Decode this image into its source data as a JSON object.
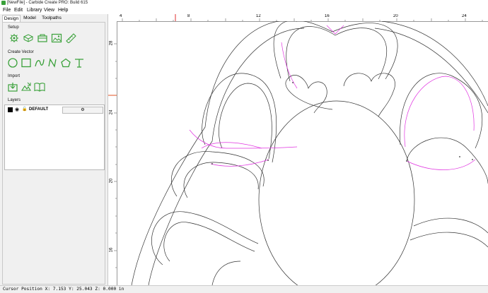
{
  "window": {
    "title": "[NewFile] - Carbide Create PRO: Build 615"
  },
  "menu": {
    "items": [
      "File",
      "Edit",
      "Library",
      "View",
      "Help"
    ]
  },
  "tabs": [
    "Design",
    "Model",
    "Toolpaths"
  ],
  "sections": {
    "setup": "Setup",
    "create_vector": "Create Vector",
    "import": "Import",
    "layers": "Layers"
  },
  "icons": {
    "setup": [
      "job-setup-icon",
      "plane-icon",
      "toolbox-icon",
      "image-icon",
      "ruler-icon"
    ],
    "create_vector": [
      "circle-icon",
      "rectangle-icon",
      "curve-icon",
      "polyline-icon",
      "polygon-icon",
      "text-icon"
    ],
    "import": [
      "import-file-icon",
      "import-image-icon",
      "open-book-icon"
    ]
  },
  "layers": [
    {
      "name": "DEFAULT",
      "color": "#000000"
    }
  ],
  "ruler": {
    "x_ticks": [
      "4",
      "8",
      "12",
      "16",
      "20",
      "24"
    ],
    "y_ticks": [
      "28",
      "24",
      "20",
      "16"
    ]
  },
  "status": {
    "cursor": "Cursor Position X: 7.153 Y: 25.043 Z: 0.000 in"
  },
  "colors": {
    "accent_icon": "#3aa13a",
    "selected_path": "#e033e0",
    "cursor_marker": "#e03030"
  }
}
